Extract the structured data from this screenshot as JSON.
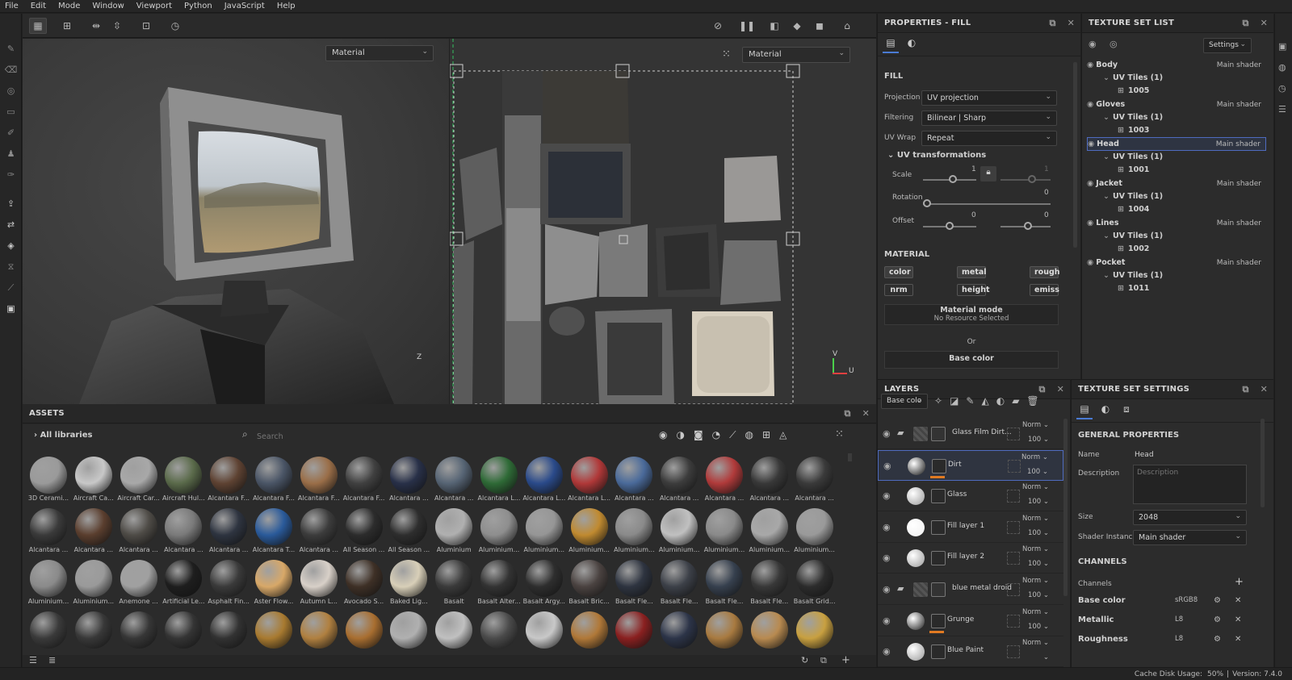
{
  "menu": [
    "File",
    "Edit",
    "Mode",
    "Window",
    "Viewport",
    "Python",
    "JavaScript",
    "Help"
  ],
  "viewport3d": {
    "select_label": "Material",
    "axis_label": "Z"
  },
  "viewport2d": {
    "select_label": "Material",
    "axis_label_v": "V",
    "axis_label_u": "U"
  },
  "properties": {
    "title": "PROPERTIES - FILL",
    "fill_header": "FILL",
    "projection_label": "Projection",
    "projection_value": "UV projection",
    "filtering_label": "Filtering",
    "filtering_value": "Bilinear | Sharp",
    "uvwrap_label": "UV Wrap",
    "uvwrap_value": "Repeat",
    "uvtrans_header": "UV transformations",
    "scale_label": "Scale",
    "scale_value": "1",
    "scale_value2": "1",
    "rotation_label": "Rotation",
    "rotation_value": "0",
    "offset_label": "Offset",
    "offset_value": "0",
    "offset_value2": "0",
    "material_header": "MATERIAL",
    "chips": [
      "color",
      "metal",
      "rough",
      "nrm",
      "height",
      "emiss"
    ],
    "material_mode_title": "Material mode",
    "material_mode_sub": "No Resource Selected",
    "or_label": "Or",
    "base_color_label": "Base color"
  },
  "texture_set_list": {
    "title": "TEXTURE SET LIST",
    "settings_label": "Settings",
    "sets": [
      {
        "name": "Body",
        "shader": "Main shader",
        "tiles": "UV Tiles (1)",
        "tile": "1005"
      },
      {
        "name": "Gloves",
        "shader": "Main shader",
        "tiles": "UV Tiles (1)",
        "tile": "1003"
      },
      {
        "name": "Head",
        "shader": "Main shader",
        "tiles": "UV Tiles (1)",
        "tile": "1001"
      },
      {
        "name": "Jacket",
        "shader": "Main shader",
        "tiles": "UV Tiles (1)",
        "tile": "1004"
      },
      {
        "name": "Lines",
        "shader": "Main shader",
        "tiles": "UV Tiles (1)",
        "tile": "1002"
      },
      {
        "name": "Pocket",
        "shader": "Main shader",
        "tiles": "UV Tiles (1)",
        "tile": "1011"
      }
    ]
  },
  "layers": {
    "title": "LAYERS",
    "channel_select": "Base colo",
    "rows": [
      {
        "name": "Glass Film Dirt...",
        "blend": "Norm",
        "opacity": "100"
      },
      {
        "name": "Dirt",
        "blend": "Norm",
        "opacity": "100"
      },
      {
        "name": "Glass",
        "blend": "Norm",
        "opacity": "100"
      },
      {
        "name": "Fill layer 1",
        "blend": "Norm",
        "opacity": "100"
      },
      {
        "name": "Fill layer 2",
        "blend": "Norm",
        "opacity": "100"
      },
      {
        "name": "blue metal droid",
        "blend": "Norm",
        "opacity": "100"
      },
      {
        "name": "Grunge",
        "blend": "Norm",
        "opacity": "100"
      },
      {
        "name": "Blue Paint",
        "blend": "Norm",
        "opacity": ""
      }
    ]
  },
  "texture_set_settings": {
    "title": "TEXTURE SET SETTINGS",
    "general_header": "GENERAL PROPERTIES",
    "name_label": "Name",
    "name_value": "Head",
    "description_label": "Description",
    "description_placeholder": "Description",
    "size_label": "Size",
    "size_value": "2048",
    "shader_label": "Shader Instance",
    "shader_value": "Main shader",
    "channels_header": "CHANNELS",
    "channels_label": "Channels",
    "channels": [
      {
        "name": "Base color",
        "format": "sRGB8"
      },
      {
        "name": "Metallic",
        "format": "L8"
      },
      {
        "name": "Roughness",
        "format": "L8"
      }
    ]
  },
  "assets": {
    "title": "ASSETS",
    "library_label": "All libraries",
    "search_placeholder": "Search",
    "items": [
      [
        "3D Cerami...",
        "Aircraft Ca...",
        "Aircraft Car...",
        "Aircraft Hul...",
        "Alcantara F...",
        "Alcantara F...",
        "Alcantara F...",
        "Alcantara F...",
        "Alcantara ...",
        "Alcantara ...",
        "Alcantara L...",
        "Alcantara L...",
        "Alcantara L...",
        "Alcantara ...",
        "Alcantara ...",
        "Alcantara ...",
        "Alcantara ...",
        "Alcantara ..."
      ],
      [
        "Alcantara ...",
        "Alcantara ...",
        "Alcantara ...",
        "Alcantara ...",
        "Alcantara ...",
        "Alcantara T...",
        "Alcantara ...",
        "All Season ...",
        "All Season ...",
        "Aluminium",
        "Aluminium...",
        "Aluminium...",
        "Aluminium...",
        "Aluminium...",
        "Aluminium...",
        "Aluminium...",
        "Aluminium...",
        "Aluminium..."
      ],
      [
        "Aluminium...",
        "Aluminium...",
        "Anemone ...",
        "Artificial Le...",
        "Asphalt Fin...",
        "Aster Flow...",
        "Autumn L...",
        "Avocado S...",
        "Baked Lig...",
        "Basalt",
        "Basalt Alter...",
        "Basalt Argy...",
        "Basalt Bric...",
        "Basalt Fle...",
        "Basalt Fle...",
        "Basalt Fle...",
        "Basalt Fle...",
        "Basalt Grid..."
      ]
    ],
    "colors": [
      [
        "#9a9a9a",
        "#c8c8c8",
        "#a8a8a8",
        "#5a6a4a",
        "#5e4232",
        "#4a5566",
        "#9a6e48",
        "#404040",
        "#283048",
        "#566474",
        "#2e6a36",
        "#2a4a8a",
        "#b03838",
        "#4a6a9a",
        "#3c3c3c",
        "#b03a3a",
        "#383838",
        "#3a3a3a"
      ],
      [
        "#3a3a3a",
        "#5a3e2e",
        "#4e4b46",
        "#7a7a7a",
        "#2e3440",
        "#2a5a9a",
        "#3c3c3c",
        "#2c2c2c",
        "#2e2e2e",
        "#b0b0b0",
        "#8e8e8e",
        "#969696",
        "#c08a30",
        "#8a8a8a",
        "#c0c0c0",
        "#8a8a8a",
        "#a8a8a8",
        "#9a9a9a"
      ],
      [
        "#8a8a8a",
        "#9a9a9a",
        "#a0a0a0",
        "#1e1e1e",
        "#3a3a3a",
        "#d8a868",
        "#d8d0c8",
        "#3e3026",
        "#d8cfb8",
        "#3a3a3a",
        "#333333",
        "#2e2e2e",
        "#4a4240",
        "#2e3440",
        "#3c4048",
        "#36404e",
        "#383838",
        "#2c2c2c"
      ],
      [
        "#3a3a3a",
        "#383838",
        "#363636",
        "#343434",
        "#323232",
        "#a87a30",
        "#b08040",
        "#a86e30",
        "#b0b0b0",
        "#c0c0c0",
        "#4a4a4a",
        "#c8c8c8",
        "#b07838",
        "#8a2020",
        "#2c3448",
        "#a87a40",
        "#b88a50",
        "#c8a040"
      ]
    ]
  },
  "status": {
    "cache": "Cache Disk Usage:",
    "cache_value": "50%",
    "version": "Version: 7.4.0"
  }
}
